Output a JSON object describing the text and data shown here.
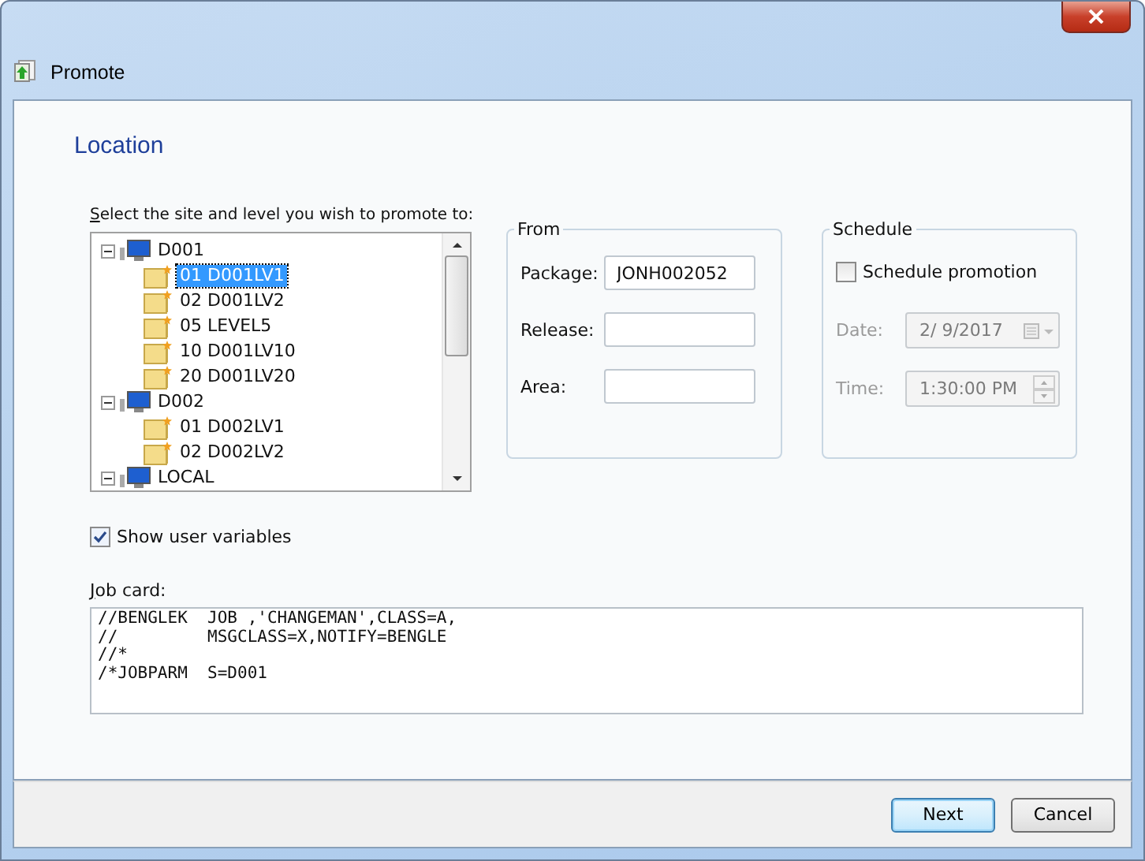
{
  "window": {
    "title": "Promote"
  },
  "heading": "Location",
  "tree_label": "Select the site and level you wish to promote to:",
  "tree": [
    {
      "label": "D001",
      "expanded": true,
      "children": [
        {
          "label": "01  D001LV1",
          "selected": true
        },
        {
          "label": "02  D001LV2",
          "selected": false
        },
        {
          "label": "05  LEVEL5",
          "selected": false
        },
        {
          "label": "10  D001LV10",
          "selected": false
        },
        {
          "label": "20  D001LV20",
          "selected": false
        }
      ]
    },
    {
      "label": "D002",
      "expanded": true,
      "children": [
        {
          "label": "01  D002LV1",
          "selected": false
        },
        {
          "label": "02  D002LV2",
          "selected": false
        }
      ]
    },
    {
      "label": "LOCAL",
      "expanded": true
    }
  ],
  "from": {
    "title": "From",
    "fields": [
      {
        "label": "Package:",
        "value": "JONH002052"
      },
      {
        "label": "Release:"
      },
      {
        "label": "Area:"
      }
    ]
  },
  "schedule": {
    "title": "Schedule",
    "checkbox": {
      "label": "Schedule promotion",
      "checked": false
    },
    "date": {
      "label": "Date:",
      "value": "2/ 9/2017",
      "disabled": true
    },
    "time": {
      "label": "Time:",
      "value": "1:30:00 PM",
      "disabled": true
    }
  },
  "show_user_variables": {
    "label": "Show user variables",
    "checked": true
  },
  "job_card": {
    "label": "Job card:",
    "lines": [
      "//BENGLEK  JOB ,'CHANGEMAN',CLASS=A,",
      "//         MSGCLASS=X,NOTIFY=BENGLE",
      "//*",
      "/*JOBPARM  S=D001"
    ]
  },
  "buttons": [
    {
      "label": "Next",
      "kind": "default"
    },
    {
      "label": "Cancel",
      "kind": "normal"
    }
  ]
}
